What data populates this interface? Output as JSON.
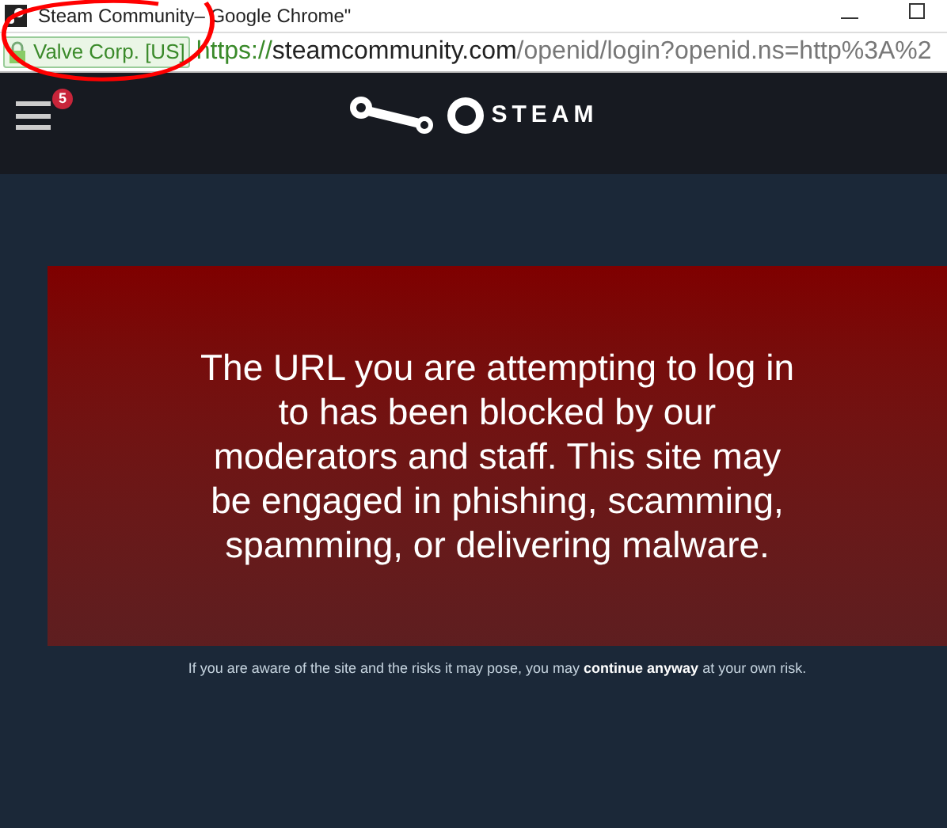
{
  "window": {
    "title": "Steam Community– Google Chrome\""
  },
  "address_bar": {
    "certificate": "Valve Corp. [US]",
    "url": {
      "scheme": "https://",
      "host": "steamcommunity.com",
      "path": "/openid/login?openid.ns=http%3A%2"
    }
  },
  "header": {
    "menu_badge": "5",
    "logo_text": "STEAM"
  },
  "warning": {
    "message": "The URL you are attempting to log in to has been blocked by our moderators and staff. This site may be engaged in phishing, scamming, spamming, or delivering malware."
  },
  "footer": {
    "before": "If you are aware of the site and the risks it may pose, you may ",
    "link": "continue anyway",
    "after": " at your own risk."
  },
  "annotation": {
    "kind": "circle"
  }
}
